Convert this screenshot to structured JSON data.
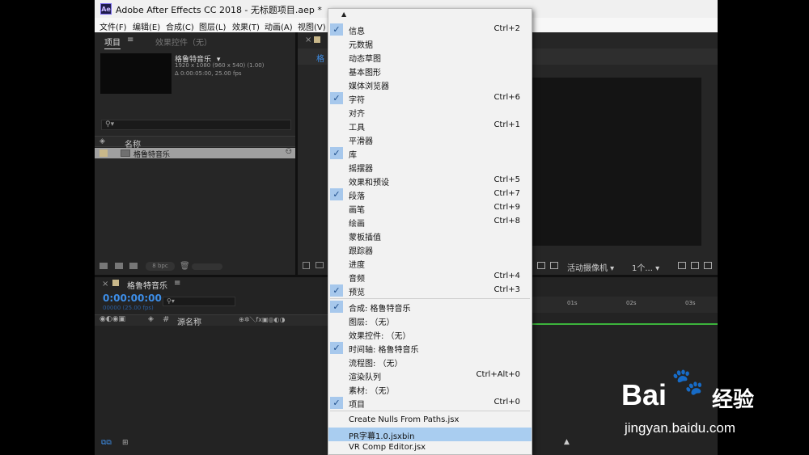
{
  "window": {
    "title": "Adobe After Effects CC 2018 - 无标题项目.aep *",
    "app_badge": "Ae"
  },
  "menubar": [
    "文件(F)",
    "编辑(E)",
    "合成(C)",
    "图层(L)",
    "效果(T)",
    "动画(A)",
    "视图(V)"
  ],
  "project_panel": {
    "tab_project": "项目",
    "tab_effects": "效果控件（无）",
    "comp_name": "格鲁特音乐",
    "comp_info_line1": "1920 x 1080  (960 x 540) (1.00)",
    "comp_info_line2": "Δ 0:00:05:00, 25.00 fps",
    "column_name": "名称",
    "item_name": "格鲁特音乐",
    "bpc": "8 bpc"
  },
  "comp_tab": "格",
  "timeline": {
    "tab_title": "格鲁特音乐",
    "timecode": "0:00:00:00",
    "timecode_sub": "00000 (25.00 fps)",
    "col_source": "源名称",
    "ruler": [
      "01s",
      "02s",
      "03s"
    ]
  },
  "viewer_controls": {
    "camera": "活动摄像机",
    "views": "1个..."
  },
  "window_menu": {
    "items": [
      {
        "label": "信息",
        "shortcut": "Ctrl+2",
        "checked": true
      },
      {
        "label": "元数据",
        "shortcut": "",
        "checked": false
      },
      {
        "label": "动态草图",
        "shortcut": "",
        "checked": false
      },
      {
        "label": "基本图形",
        "shortcut": "",
        "checked": false
      },
      {
        "label": "媒体浏览器",
        "shortcut": "",
        "checked": false
      },
      {
        "label": "字符",
        "shortcut": "Ctrl+6",
        "checked": true
      },
      {
        "label": "对齐",
        "shortcut": "",
        "checked": false
      },
      {
        "label": "工具",
        "shortcut": "Ctrl+1",
        "checked": false
      },
      {
        "label": "平滑器",
        "shortcut": "",
        "checked": false
      },
      {
        "label": "库",
        "shortcut": "",
        "checked": true
      },
      {
        "label": "摇摆器",
        "shortcut": "",
        "checked": false
      },
      {
        "label": "效果和预设",
        "shortcut": "Ctrl+5",
        "checked": false
      },
      {
        "label": "段落",
        "shortcut": "Ctrl+7",
        "checked": true
      },
      {
        "label": "画笔",
        "shortcut": "Ctrl+9",
        "checked": false
      },
      {
        "label": "绘画",
        "shortcut": "Ctrl+8",
        "checked": false
      },
      {
        "label": "蒙板插值",
        "shortcut": "",
        "checked": false
      },
      {
        "label": "跟踪器",
        "shortcut": "",
        "checked": false
      },
      {
        "label": "进度",
        "shortcut": "",
        "checked": false
      },
      {
        "label": "音频",
        "shortcut": "Ctrl+4",
        "checked": false
      },
      {
        "label": "预览",
        "shortcut": "Ctrl+3",
        "checked": true
      }
    ],
    "panels": [
      {
        "label": "合成: 格鲁特音乐",
        "shortcut": "",
        "checked": true
      },
      {
        "label": "图层: （无）",
        "shortcut": "",
        "checked": false
      },
      {
        "label": "效果控件: （无）",
        "shortcut": "",
        "checked": false
      },
      {
        "label": "时间轴: 格鲁特音乐",
        "shortcut": "",
        "checked": true
      },
      {
        "label": "流程图: （无）",
        "shortcut": "",
        "checked": false
      },
      {
        "label": "渲染队列",
        "shortcut": "Ctrl+Alt+0",
        "checked": false
      },
      {
        "label": "素材: （无）",
        "shortcut": "",
        "checked": false
      },
      {
        "label": "项目",
        "shortcut": "Ctrl+0",
        "checked": true
      }
    ],
    "scripts": [
      {
        "label": "Create Nulls From Paths.jsx",
        "highlighted": false
      },
      {
        "label": "PR字幕1.0.jsxbin",
        "highlighted": true
      },
      {
        "label": "VR Comp Editor.jsx",
        "highlighted": false
      }
    ]
  },
  "watermark": {
    "logo_text": "Bai",
    "logo_suffix": "经验",
    "url": "jingyan.baidu.com"
  }
}
